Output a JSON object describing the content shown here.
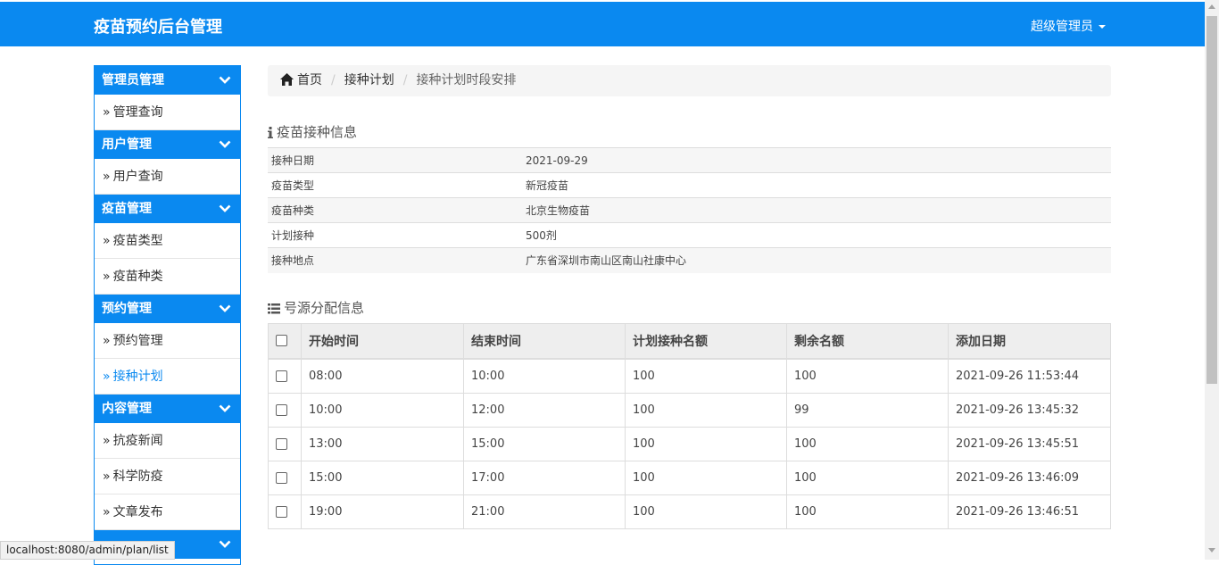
{
  "header": {
    "brand": "疫苗预约后台管理",
    "user": "超级管理员"
  },
  "sidebar": {
    "groups": [
      {
        "title": "管理员管理",
        "items": [
          "管理查询"
        ]
      },
      {
        "title": "用户管理",
        "items": [
          "用户查询"
        ]
      },
      {
        "title": "疫苗管理",
        "items": [
          "疫苗类型",
          "疫苗种类"
        ]
      },
      {
        "title": "预约管理",
        "items": [
          "预约管理",
          "接种计划"
        ]
      },
      {
        "title": "内容管理",
        "items": [
          "抗疫新闻",
          "科学防疫",
          "文章发布"
        ]
      },
      {
        "title": "",
        "items": []
      }
    ],
    "active_item": "接种计划"
  },
  "status_url": "localhost:8080/admin/plan/list",
  "breadcrumb": {
    "home": "首页",
    "level2": "接种计划",
    "current": "接种计划时段安排"
  },
  "info_section": {
    "title": "疫苗接种信息",
    "rows": [
      {
        "label": "接种日期",
        "value": "2021-09-29"
      },
      {
        "label": "疫苗类型",
        "value": "新冠疫苗"
      },
      {
        "label": "疫苗种类",
        "value": "北京生物疫苗"
      },
      {
        "label": "计划接种",
        "value": "500剂"
      },
      {
        "label": "接种地点",
        "value": "广东省深圳市南山区南山社康中心"
      }
    ]
  },
  "slots_section": {
    "title": "号源分配信息",
    "columns": [
      "开始时间",
      "结束时间",
      "计划接种名额",
      "剩余名额",
      "添加日期"
    ],
    "rows": [
      [
        "08:00",
        "10:00",
        "100",
        "100",
        "2021-09-26 11:53:44"
      ],
      [
        "10:00",
        "12:00",
        "100",
        "99",
        "2021-09-26 13:45:32"
      ],
      [
        "13:00",
        "15:00",
        "100",
        "100",
        "2021-09-26 13:45:51"
      ],
      [
        "15:00",
        "17:00",
        "100",
        "100",
        "2021-09-26 13:46:09"
      ],
      [
        "19:00",
        "21:00",
        "100",
        "100",
        "2021-09-26 13:46:51"
      ]
    ]
  },
  "colors": {
    "primary": "#0a89f0",
    "active_link": "#0a89f0"
  }
}
